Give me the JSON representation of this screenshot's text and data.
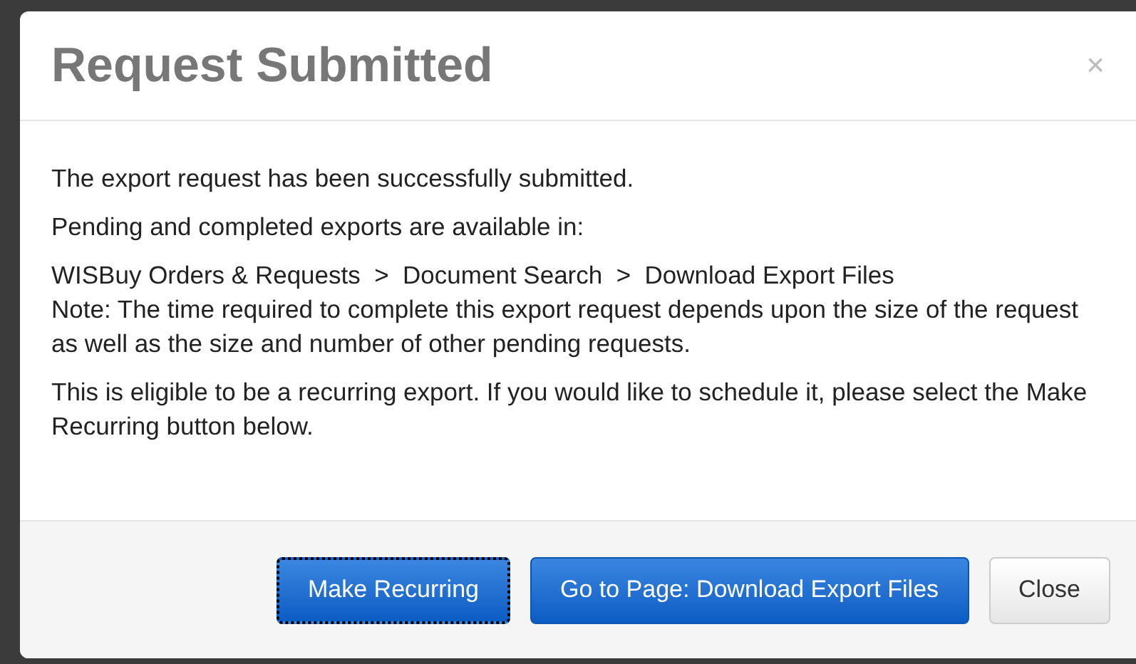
{
  "dialog": {
    "title": "Request Submitted",
    "close_icon": "×",
    "paragraphs": [
      {
        "lines": [
          "The export request has been successfully submitted."
        ]
      },
      {
        "lines": [
          "Pending and completed exports are available in:"
        ]
      },
      {
        "lines": [
          "WISBuy Orders & Requests  >  Document Search  >  Download Export Files",
          "Note: The time required to complete this export request depends upon the size of the request as well as the size and number of other pending requests."
        ]
      },
      {
        "lines": [
          "This is eligible to be a recurring export. If you would like to schedule it, please select the Make Recurring button below."
        ]
      }
    ],
    "buttons": [
      {
        "label": "Make Recurring",
        "kind": "primary",
        "focused": true
      },
      {
        "label": "Go to Page: Download Export Files",
        "kind": "primary",
        "focused": false
      },
      {
        "label": "Close",
        "kind": "default",
        "focused": false
      }
    ]
  }
}
